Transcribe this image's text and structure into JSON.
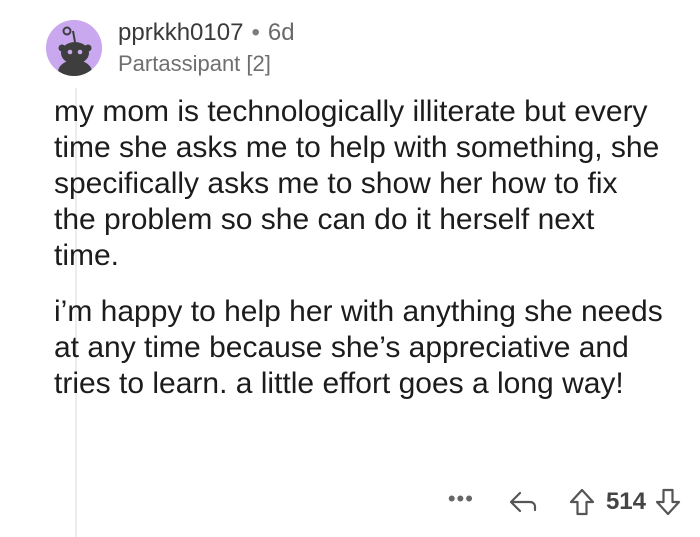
{
  "comment": {
    "author": "pprkkh0107",
    "separator": "•",
    "age": "6d",
    "flair": "Partassipant [2]",
    "paragraphs": [
      "my mom is technologically illiterate but every time she asks me to help with something, she specifically asks me to show her how to fix the problem so she can do it herself next time.",
      "i’m happy to help her with anything she needs at any time because she’s appreciative and tries to learn. a little effort goes a long way!"
    ],
    "actions": {
      "more": "•••",
      "score": "514"
    }
  },
  "icons": {
    "avatar": "snoo-avatar-icon",
    "more": "more-options-icon",
    "reply": "reply-arrow-icon",
    "upvote": "upvote-arrow-icon",
    "downvote": "downvote-arrow-icon"
  },
  "colors": {
    "avatar_bg": "#c9a8f0",
    "text": "#1c1c1c",
    "muted": "#6f6f6f"
  }
}
